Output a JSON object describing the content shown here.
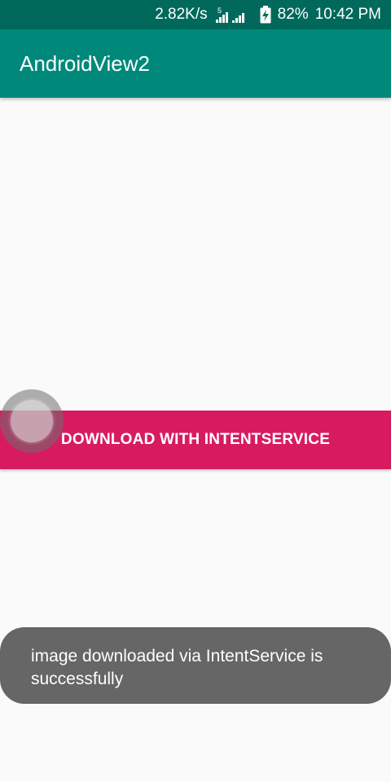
{
  "status_bar": {
    "net_speed": "2.82K/s",
    "signal_label": "5",
    "battery_percent": "82%",
    "time": "10:42 PM",
    "icons": [
      "signal-icon",
      "battery-charging-icon"
    ]
  },
  "app_bar": {
    "title": "AndroidView2",
    "color": "#00897b"
  },
  "main": {
    "download_button_label": "DOWNLOAD WITH INTENTSERVICE",
    "button_color": "#d81b60"
  },
  "toast": {
    "message": "image downloaded via IntentService is successfully"
  }
}
